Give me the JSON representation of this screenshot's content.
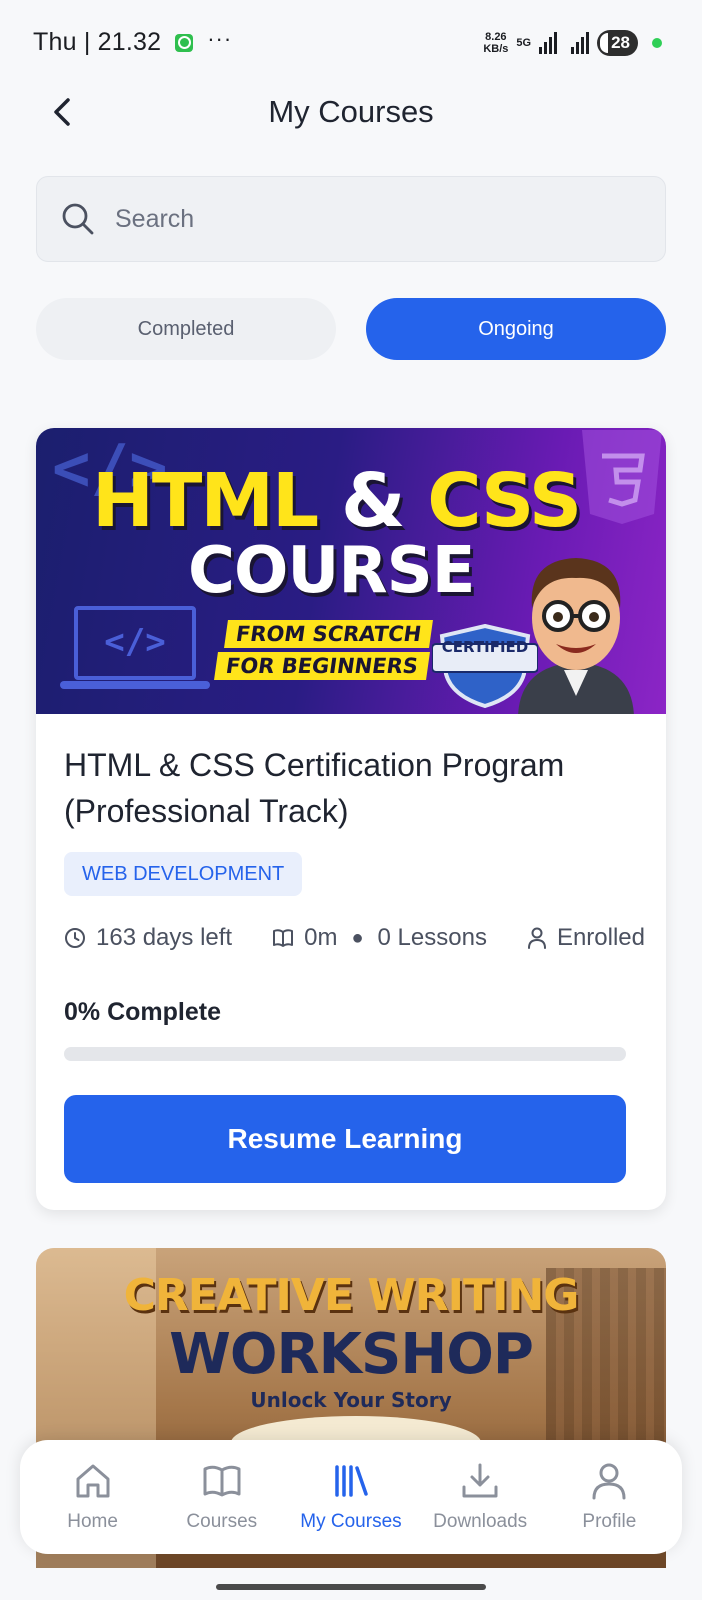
{
  "status_bar": {
    "time": "Thu | 21.32",
    "dots": "···",
    "net_speed_value": "8.26",
    "net_speed_unit": "KB/s",
    "network": "5G",
    "battery": "28"
  },
  "header": {
    "title": "My Courses",
    "back_icon": "chevron-left-icon"
  },
  "search": {
    "placeholder": "Search",
    "value": "",
    "icon": "search-icon"
  },
  "tabs": [
    {
      "label": "Completed",
      "active": false
    },
    {
      "label": "Ongoing",
      "active": true
    }
  ],
  "courses": [
    {
      "banner": {
        "title_main": "HTML",
        "title_amp": "&",
        "title_css": "CSS",
        "subtitle": "COURSE",
        "ribbon_1": "FROM SCRATCH",
        "ribbon_2": "FOR BEGINNERS",
        "badge": "CERTIFIED"
      },
      "title": "HTML & CSS Certification Program (Professional Track)",
      "category": "WEB DEVELOPMENT",
      "days_left": "163 days left",
      "duration": "0m",
      "lessons": "0 Lessons",
      "status": "Enrolled",
      "progress_label": "0% Complete",
      "progress_percent": 0,
      "button_label": "Resume Learning"
    },
    {
      "banner": {
        "title_main": "CREATIVE WRITING",
        "subtitle": "WORKSHOP",
        "tagline": "Unlock Your Story"
      }
    }
  ],
  "bottom_nav": [
    {
      "label": "Home",
      "icon": "home-icon",
      "active": false
    },
    {
      "label": "Courses",
      "icon": "book-icon",
      "active": false
    },
    {
      "label": "My Courses",
      "icon": "library-icon",
      "active": true
    },
    {
      "label": "Downloads",
      "icon": "download-icon",
      "active": false
    },
    {
      "label": "Profile",
      "icon": "user-icon",
      "active": false
    }
  ],
  "colors": {
    "accent": "#2563eb",
    "background": "#f7f8fa",
    "tag_bg": "#e9effc"
  }
}
